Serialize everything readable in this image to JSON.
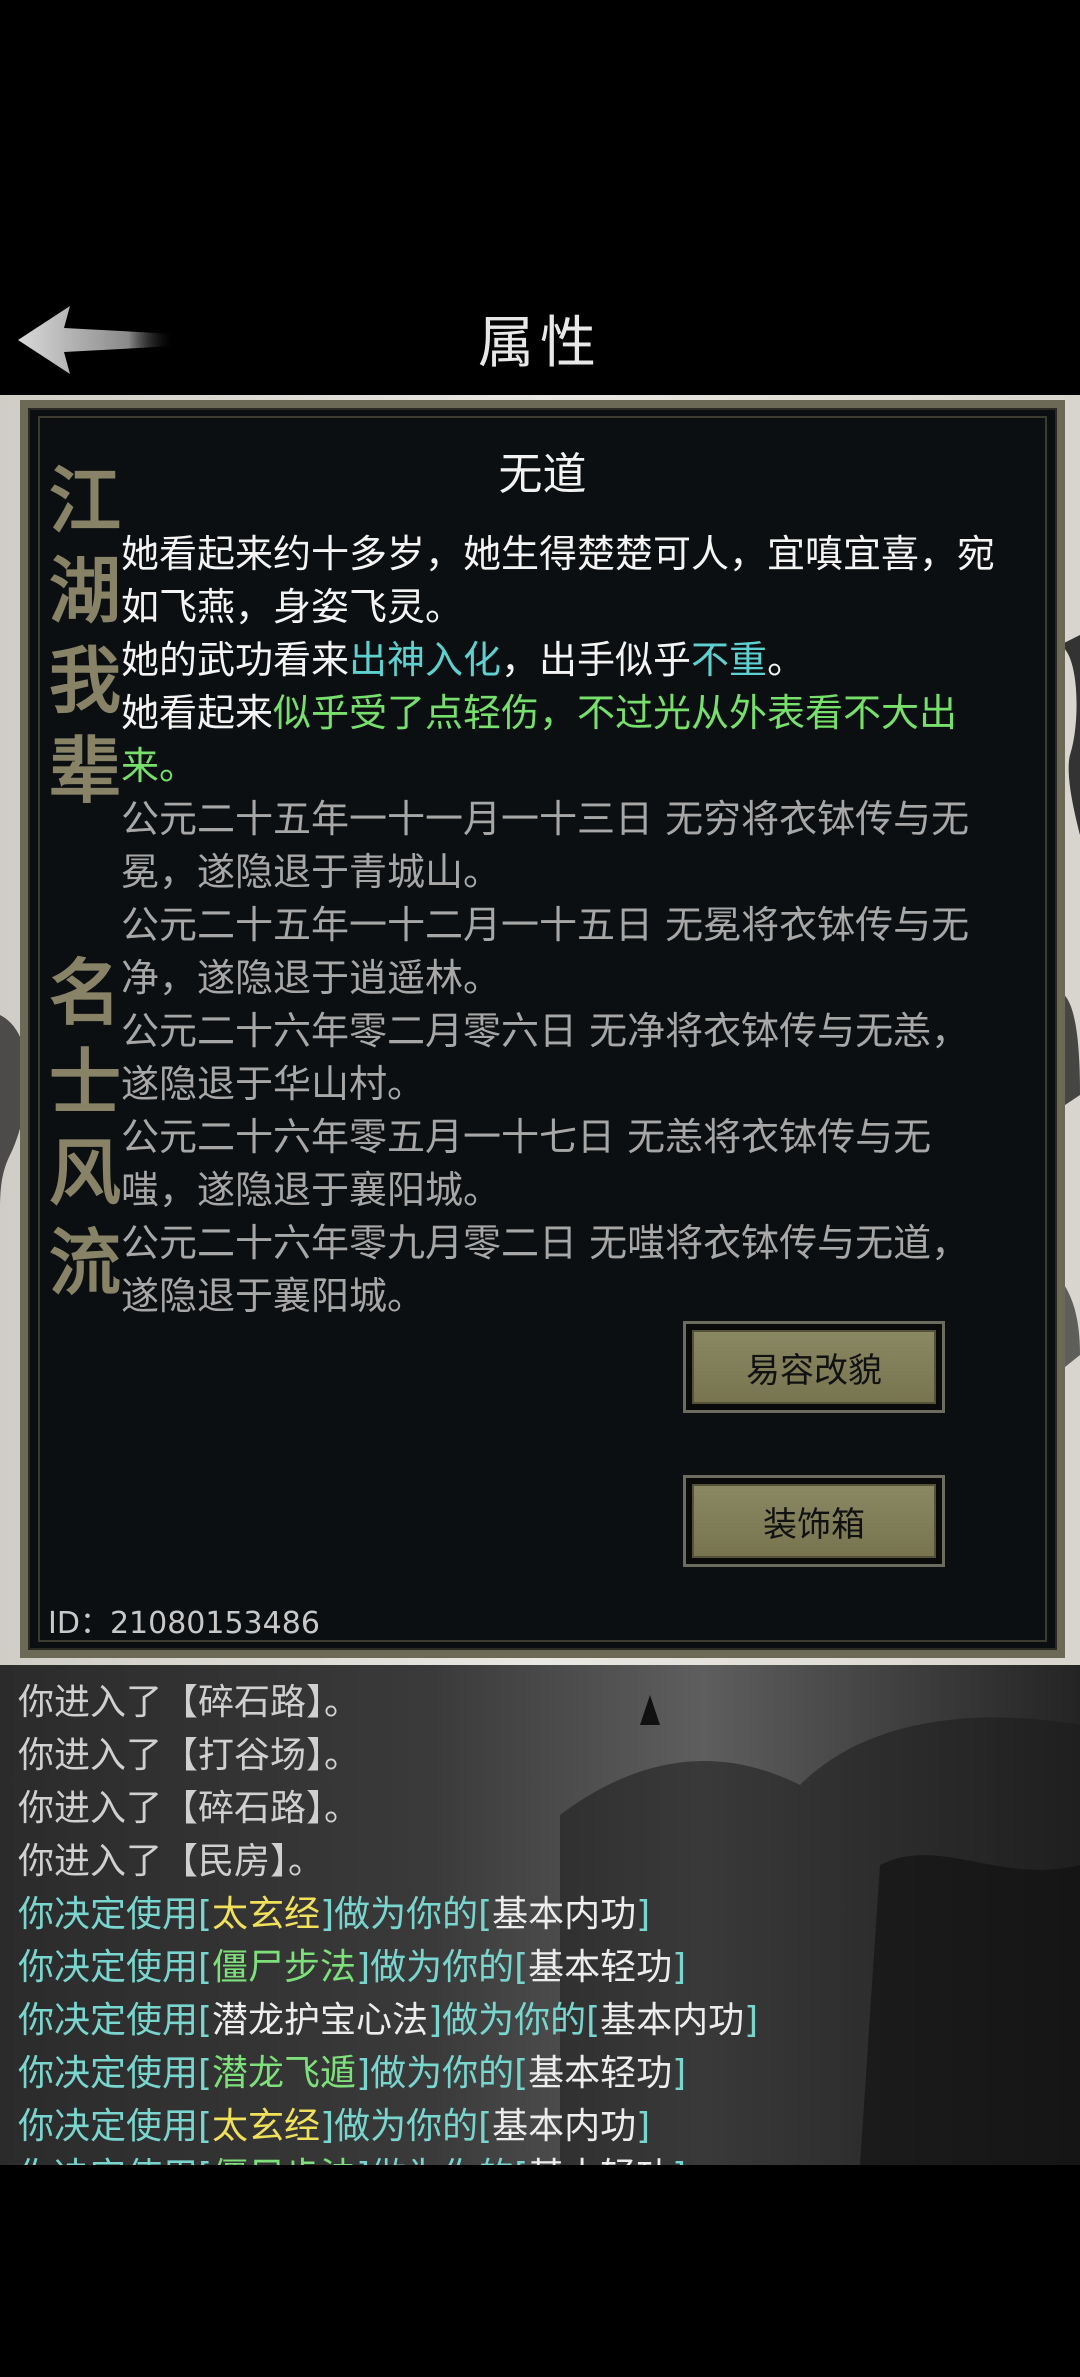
{
  "header": {
    "title": "属性"
  },
  "panel": {
    "calligraphy_top": [
      "江",
      "湖",
      "我",
      "辈"
    ],
    "calligraphy_bottom": [
      "名",
      "士",
      "风",
      "流"
    ],
    "character_name": "无道",
    "description": {
      "p1": [
        "她看起来约十多岁，她生得",
        "楚楚可人，宜嗔宜喜，宛如飞燕，身姿飞灵",
        "。"
      ],
      "p2": [
        "她的武功看来",
        "出神入化",
        "，出手似乎",
        "不重",
        "。"
      ],
      "p3": [
        "她看起来",
        "似乎受了点轻伤，不过光从外表看不大出来。"
      ],
      "history": [
        "公元二十五年一十一月一十三日 无穷将衣钵传与无冕，遂隐退于青城山。",
        "公元二十五年一十二月一十五日 无冕将衣钵传与无净，遂隐退于逍遥林。",
        "公元二十六年零二月零六日 无净将衣钵传与无恙，遂隐退于华山村。",
        "公元二十六年零五月一十七日 无恙将衣钵传与无嗤，遂隐退于襄阳城。",
        "公元二十六年零九月零二日 无嗤将衣钵传与无道，遂隐退于襄阳城。"
      ]
    },
    "buttons": {
      "disguise": "易容改貌",
      "wardrobe": "装饰箱"
    },
    "id_text": "ID：21080153486"
  },
  "log": {
    "entered": [
      [
        "你进入了",
        "【碎石路】",
        "。"
      ],
      [
        "你进入了",
        "【打谷场】",
        "。"
      ],
      [
        "你进入了",
        "【碎石路】",
        "。"
      ],
      [
        "你进入了",
        "【民房】",
        "。"
      ]
    ],
    "skills": [
      {
        "pre": "你决定使用[",
        "skill": "太玄经",
        "mid": "]做为你的[",
        "slot": "基本内功",
        "post": "]",
        "color": "yellow"
      },
      {
        "pre": "你决定使用[",
        "skill": "僵尸步法",
        "mid": "]做为你的[",
        "slot": "基本轻功",
        "post": "]",
        "color": "green"
      },
      {
        "pre": "你决定使用[",
        "skill": "潜龙护宝心法",
        "mid": "]做为你的[",
        "slot": "基本内功",
        "post": "]",
        "color": "white"
      },
      {
        "pre": "你决定使用[",
        "skill": "潜龙飞遁",
        "mid": "]做为你的[",
        "slot": "基本轻功",
        "post": "]",
        "color": "green"
      },
      {
        "pre": "你决定使用[",
        "skill": "太玄经",
        "mid": "]做为你的[",
        "slot": "基本内功",
        "post": "]",
        "color": "yellow"
      },
      {
        "pre": "你决定使用[",
        "skill": "僵尸步法",
        "mid": "]做为你的[",
        "slot": "基本轻功",
        "post": "]",
        "color": "green"
      }
    ]
  }
}
